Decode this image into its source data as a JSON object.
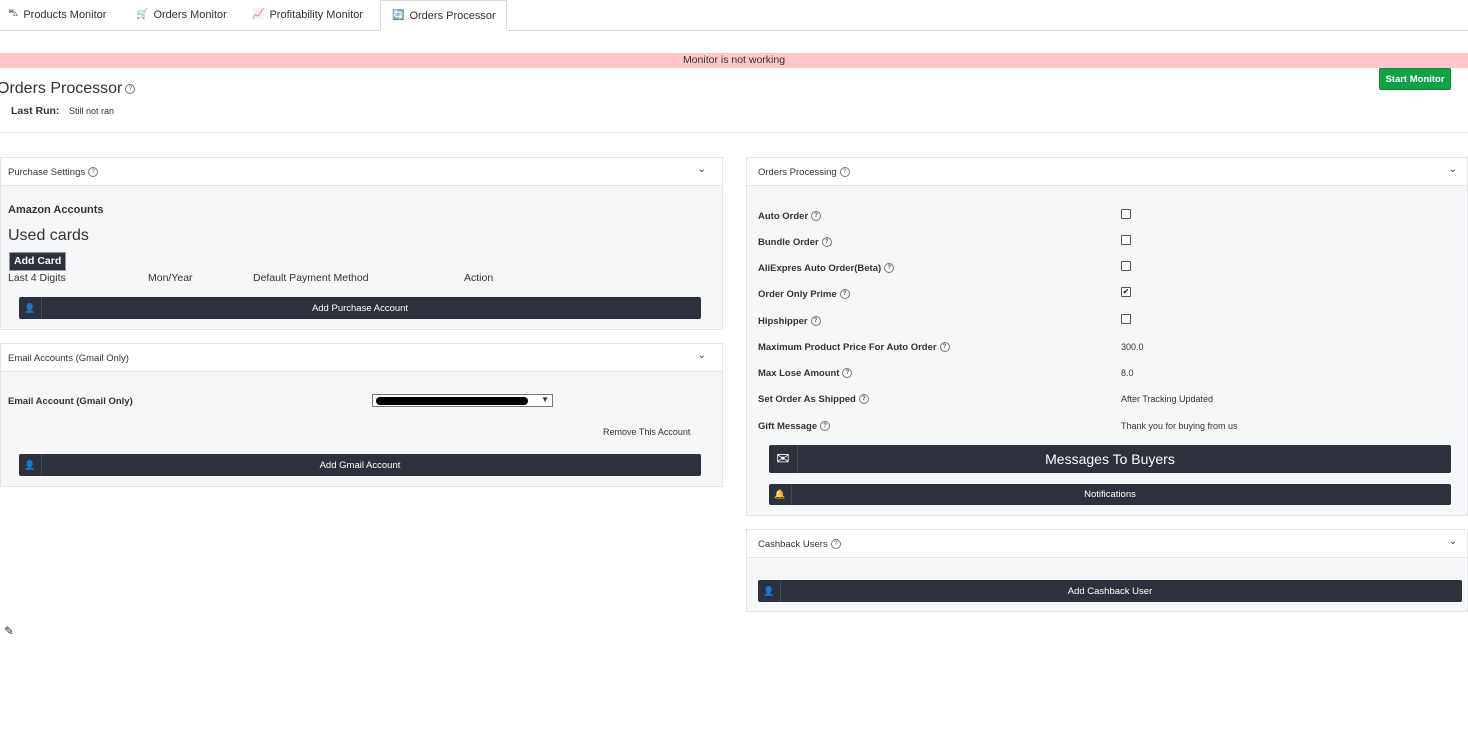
{
  "tabs": [
    {
      "label": "Products Monitor",
      "icon": "tag-icon",
      "glyph": "⛍"
    },
    {
      "label": "Orders Monitor",
      "icon": "cart-icon",
      "glyph": "🛒"
    },
    {
      "label": "Profitability Monitor",
      "icon": "chart-icon",
      "glyph": "📈"
    },
    {
      "label": "Orders Processor",
      "icon": "processor-icon",
      "glyph": "🔄"
    }
  ],
  "status_message": "Monitor is not working",
  "start_button": "Start Monitor",
  "page_title": "Orders Processor",
  "last_run": {
    "label": "Last Run:",
    "value": "Still not ran"
  },
  "purchase_settings": {
    "title": "Purchase Settings",
    "amazon_accounts": "Amazon Accounts",
    "used_cards": "Used cards",
    "add_card": "Add Card",
    "columns": [
      "Last 4 Digits",
      "Mon/Year",
      "Default Payment Method",
      "Action"
    ],
    "add_purchase_account": "Add Purchase Account"
  },
  "email_accounts": {
    "title": "Email Accounts (Gmail Only)",
    "field_label": "Email Account (Gmail Only)",
    "remove": "Remove This Account",
    "add_gmail": "Add Gmail Account"
  },
  "orders_processing": {
    "title": "Orders Processing",
    "rows": [
      {
        "label": "Auto Order",
        "type": "checkbox",
        "checked": false
      },
      {
        "label": "Bundle Order",
        "type": "checkbox",
        "checked": false
      },
      {
        "label": "AliExpres Auto Order(Beta)",
        "type": "checkbox",
        "checked": false
      },
      {
        "label": "Order Only Prime",
        "type": "checkbox",
        "checked": true
      },
      {
        "label": "Hipshipper",
        "type": "checkbox",
        "checked": false
      },
      {
        "label": "Maximum Product Price For Auto Order",
        "type": "text",
        "value": "300.0"
      },
      {
        "label": "Max Lose Amount",
        "type": "text",
        "value": "8.0"
      },
      {
        "label": "Set Order As Shipped",
        "type": "text",
        "value": "After Tracking Updated"
      },
      {
        "label": "Gift Message",
        "type": "text",
        "value": "Thank you for buying from us"
      }
    ],
    "messages_button": "Messages To Buyers",
    "notifications_button": "Notifications"
  },
  "cashback": {
    "title": "Cashback Users",
    "add_button": "Add Cashback User"
  },
  "help_glyph": "?",
  "chevron_glyph": "⌄",
  "user_icon_glyph": "👤",
  "check_glyph": "✔",
  "select_arrow": "▼"
}
